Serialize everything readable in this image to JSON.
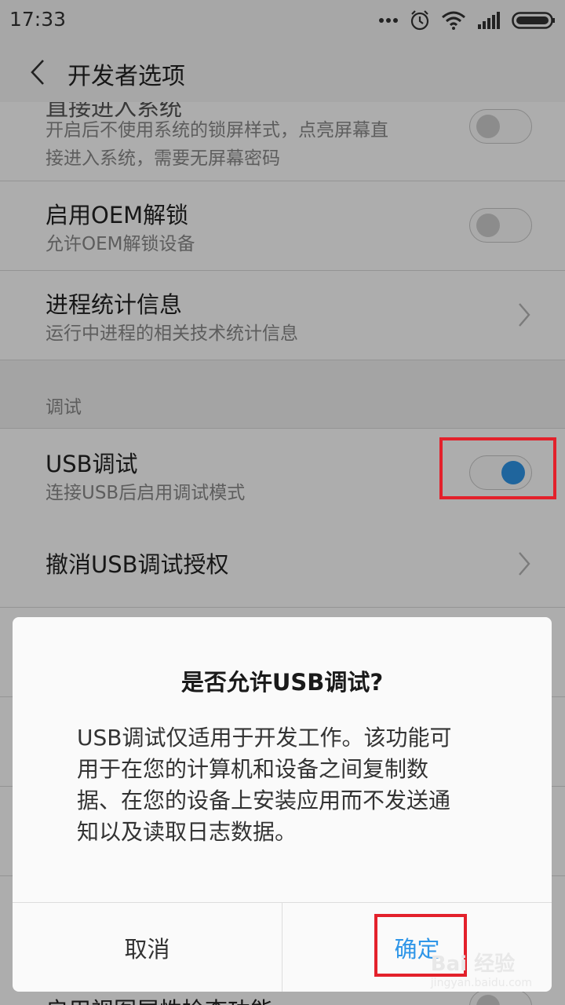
{
  "status": {
    "time": "17:33"
  },
  "header": {
    "title": "开发者选项"
  },
  "settings": {
    "direct_entry": {
      "title_partial": "直接进入系统",
      "subtitle_line1": "开启后不使用系统的锁屏样式，点亮屏幕直",
      "subtitle_line2": "接进入系统，需要无屏幕密码",
      "enabled": false
    },
    "oem_unlock": {
      "title": "启用OEM解锁",
      "subtitle": "允许OEM解锁设备",
      "enabled": false
    },
    "process_stats": {
      "title": "进程统计信息",
      "subtitle": "运行中进程的相关技术统计信息"
    },
    "section_debug": "调试",
    "usb_debug": {
      "title": "USB调试",
      "subtitle": "连接USB后启用调试模式",
      "enabled": true
    },
    "revoke_usb": {
      "title": "撤消USB调试授权"
    },
    "view_attr": {
      "title_partial": "启用视图属性检查功能",
      "enabled": false
    }
  },
  "dialog": {
    "title": "是否允许USB调试?",
    "body_lines": [
      "USB调试仅适用于开发工作。该功能可",
      "用于在您的计算机和设备之间复制数",
      "据、在您的设备上安装应用而不发送通",
      "知以及读取日志数据。"
    ],
    "cancel_label": "取消",
    "ok_label": "确定"
  },
  "watermark": {
    "brand": "Bai 经验",
    "url": "jingyan.baidu.com"
  },
  "colors": {
    "accent": "#2f96e8",
    "highlight": "#e3212b"
  }
}
